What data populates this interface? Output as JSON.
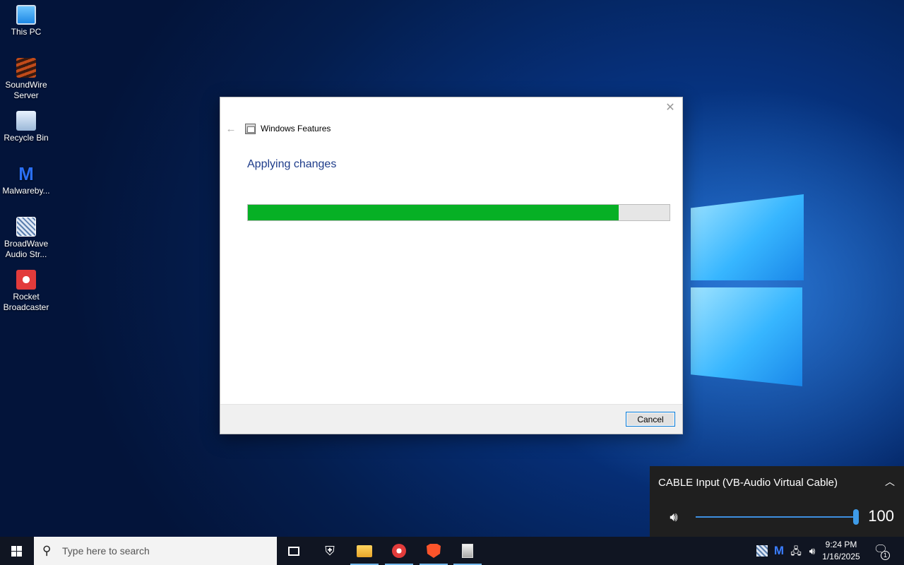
{
  "desktop": {
    "icons": [
      {
        "label": "This PC",
        "icon": "computer-icon"
      },
      {
        "label": "SoundWire Server",
        "icon": "soundwire-icon"
      },
      {
        "label": "Recycle Bin",
        "icon": "recycle-bin-icon"
      },
      {
        "label": "Malwareby...",
        "icon": "malwarebytes-icon"
      },
      {
        "label": "BroadWave Audio Str...",
        "icon": "broadwave-icon"
      },
      {
        "label": "Rocket Broadcaster",
        "icon": "rocket-broadcaster-icon"
      }
    ]
  },
  "dialog": {
    "title": "Windows Features",
    "heading": "Applying changes",
    "progress": 0.88,
    "close_glyph": "✕",
    "back_glyph": "←",
    "cancel_label": "Cancel"
  },
  "volume_flyout": {
    "device": "CABLE Input (VB-Audio Virtual Cable)",
    "level": 100,
    "level_text": "100",
    "accent": "#3e9be8"
  },
  "taskbar": {
    "search_placeholder": "Type here to search",
    "apps": [
      {
        "name": "task-view",
        "running": false
      },
      {
        "name": "windows-security",
        "running": false
      },
      {
        "name": "file-explorer",
        "running": true
      },
      {
        "name": "rocket-broadcaster",
        "running": true
      },
      {
        "name": "brave-browser",
        "running": true
      },
      {
        "name": "windows-features",
        "running": true
      }
    ],
    "clock": {
      "time": "9:24 PM",
      "date": "1/16/2025"
    },
    "notification_count": "1"
  },
  "colors": {
    "progress_fill": "#06b025",
    "heading": "#1e3c8a",
    "taskbar_bg": "#101522"
  }
}
